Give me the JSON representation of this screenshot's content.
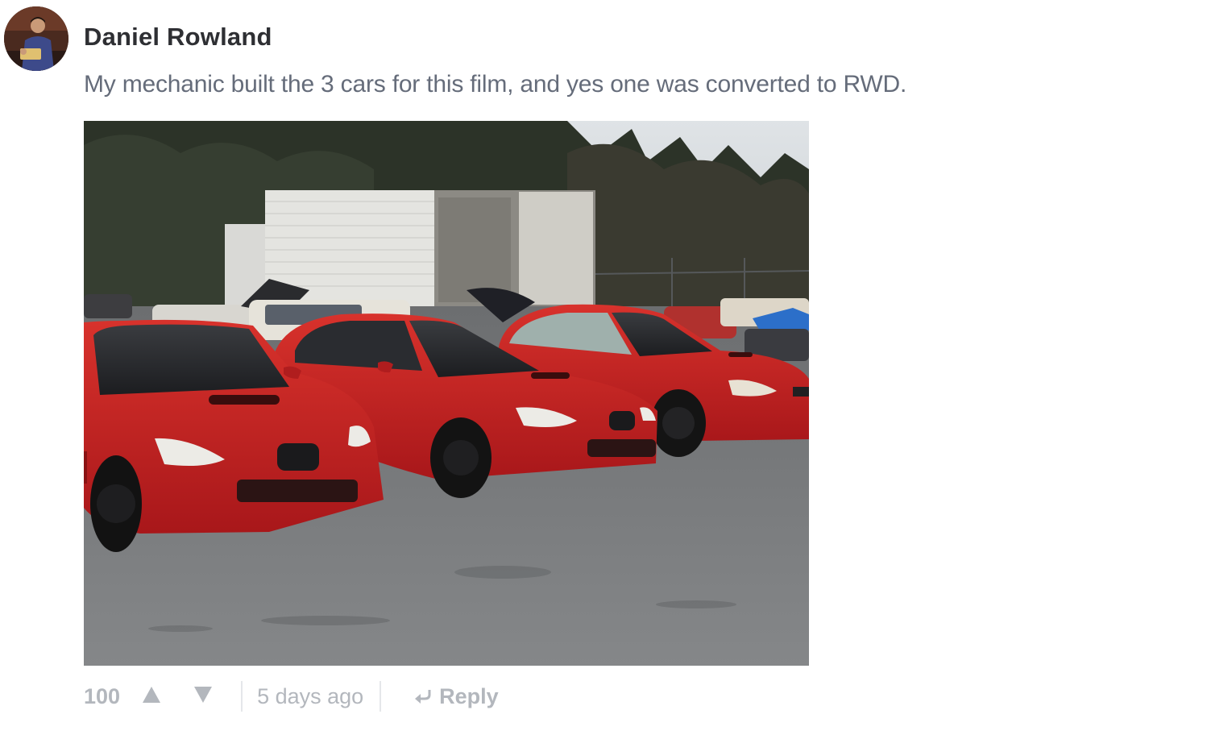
{
  "comment": {
    "author": "Daniel Rowland",
    "text": "My mechanic built the 3 cars for this film, and yes one was converted to RWD.",
    "votes": "100",
    "timestamp": "5 days ago",
    "reply_label": "Reply"
  },
  "icons": {
    "upvote": "triangle-up-icon",
    "downvote": "triangle-down-icon",
    "reply": "reply-arrow-icon"
  },
  "colors": {
    "author": "#2e2f33",
    "body_text": "#656c7a",
    "footer_muted": "#b3b7bd",
    "divider": "#e5e7ea",
    "car_red": "#c8201f"
  }
}
